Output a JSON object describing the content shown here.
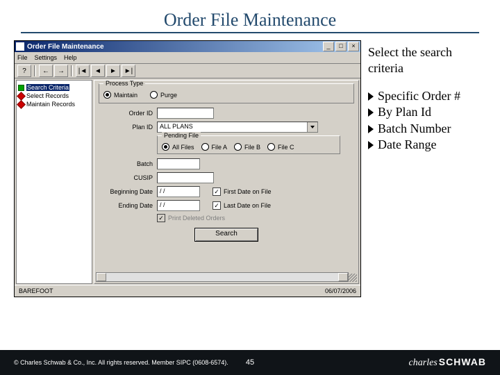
{
  "title": "Order File Maintenance",
  "right": {
    "intro": "Select the search criteria",
    "items": [
      "Specific Order #",
      "By Plan Id",
      "Batch Number",
      "Date Range"
    ]
  },
  "app": {
    "window_title": "Order File Maintenance",
    "menus": [
      "File",
      "Settings",
      "Help"
    ],
    "tree": [
      {
        "label": "Search Criteria",
        "selected": true,
        "color": "green"
      },
      {
        "label": "Select Records",
        "selected": false,
        "color": "red"
      },
      {
        "label": "Maintain Records",
        "selected": false,
        "color": "red"
      }
    ],
    "process_type": {
      "title": "Process Type",
      "options": [
        "Maintain",
        "Purge"
      ],
      "selected": "Maintain"
    },
    "labels": {
      "order_id": "Order ID",
      "plan_id": "Plan ID",
      "batch": "Batch",
      "cusip": "CUSIP",
      "beg_date": "Beginning Date",
      "end_date": "Ending Date",
      "pending_file": "Pending File"
    },
    "plan_value": "ALL PLANS",
    "pending_file": {
      "options": [
        "All Files",
        "File A",
        "File B",
        "File C"
      ],
      "selected": "All Files"
    },
    "date_value": "/ /",
    "check_first": "First Date on File",
    "check_last": "Last Date on File",
    "check_print": "Print Deleted Orders",
    "search_btn": "Search",
    "status_left": "BAREFOOT",
    "status_right": "06/07/2006"
  },
  "footer": {
    "copyright": "© Charles Schwab & Co., Inc. All rights reserved. Member SIPC (0608-6574).",
    "page": "45",
    "brand1": "charles",
    "brand2": "SCHWAB"
  }
}
